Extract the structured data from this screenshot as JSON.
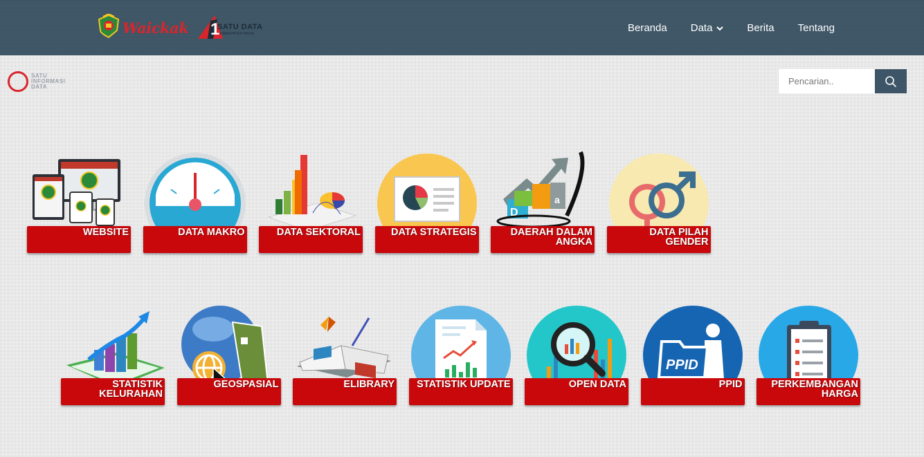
{
  "header": {
    "brand_word": "Waickak",
    "brand_secondary": "SATU DATA",
    "brand_secondary_sub": "KABUPATEN WAJO",
    "nav": {
      "home": "Beranda",
      "data": "Data",
      "news": "Berita",
      "about": "Tentang"
    }
  },
  "sublogo": {
    "line1": "SATU",
    "line2": "INFORMASI",
    "line3": "DATA"
  },
  "search": {
    "placeholder": "Pencarian.."
  },
  "tiles_row1": [
    {
      "label": "WEBSITE",
      "icon": "website-devices-icon"
    },
    {
      "label": "DATA MAKRO",
      "icon": "speedometer-gauge-icon"
    },
    {
      "label": "DATA SEKTORAL",
      "icon": "3d-bar-chart-icon"
    },
    {
      "label": "DATA STRATEGIS",
      "icon": "presentation-pie-icon"
    },
    {
      "label": "DAERAH DALAM ANGKA",
      "icon": "growth-chart-arrow-icon"
    },
    {
      "label": "DATA PILAH GENDER",
      "icon": "gender-symbols-icon"
    }
  ],
  "tiles_row2": [
    {
      "label": "STATISTIK KELURAHAN",
      "icon": "3d-growth-bars-icon"
    },
    {
      "label": "GEOSPASIAL",
      "icon": "globe-map-icon"
    },
    {
      "label": "ELIBRARY",
      "icon": "open-book-icon"
    },
    {
      "label": "STATISTIK UPDATE",
      "icon": "document-chart-icon"
    },
    {
      "label": "OPEN DATA",
      "icon": "magnifier-chart-icon"
    },
    {
      "label": "PPID",
      "icon": "ppid-folder-icon"
    },
    {
      "label": "PERKEMBANGAN HARGA",
      "icon": "clipboard-list-icon"
    }
  ]
}
